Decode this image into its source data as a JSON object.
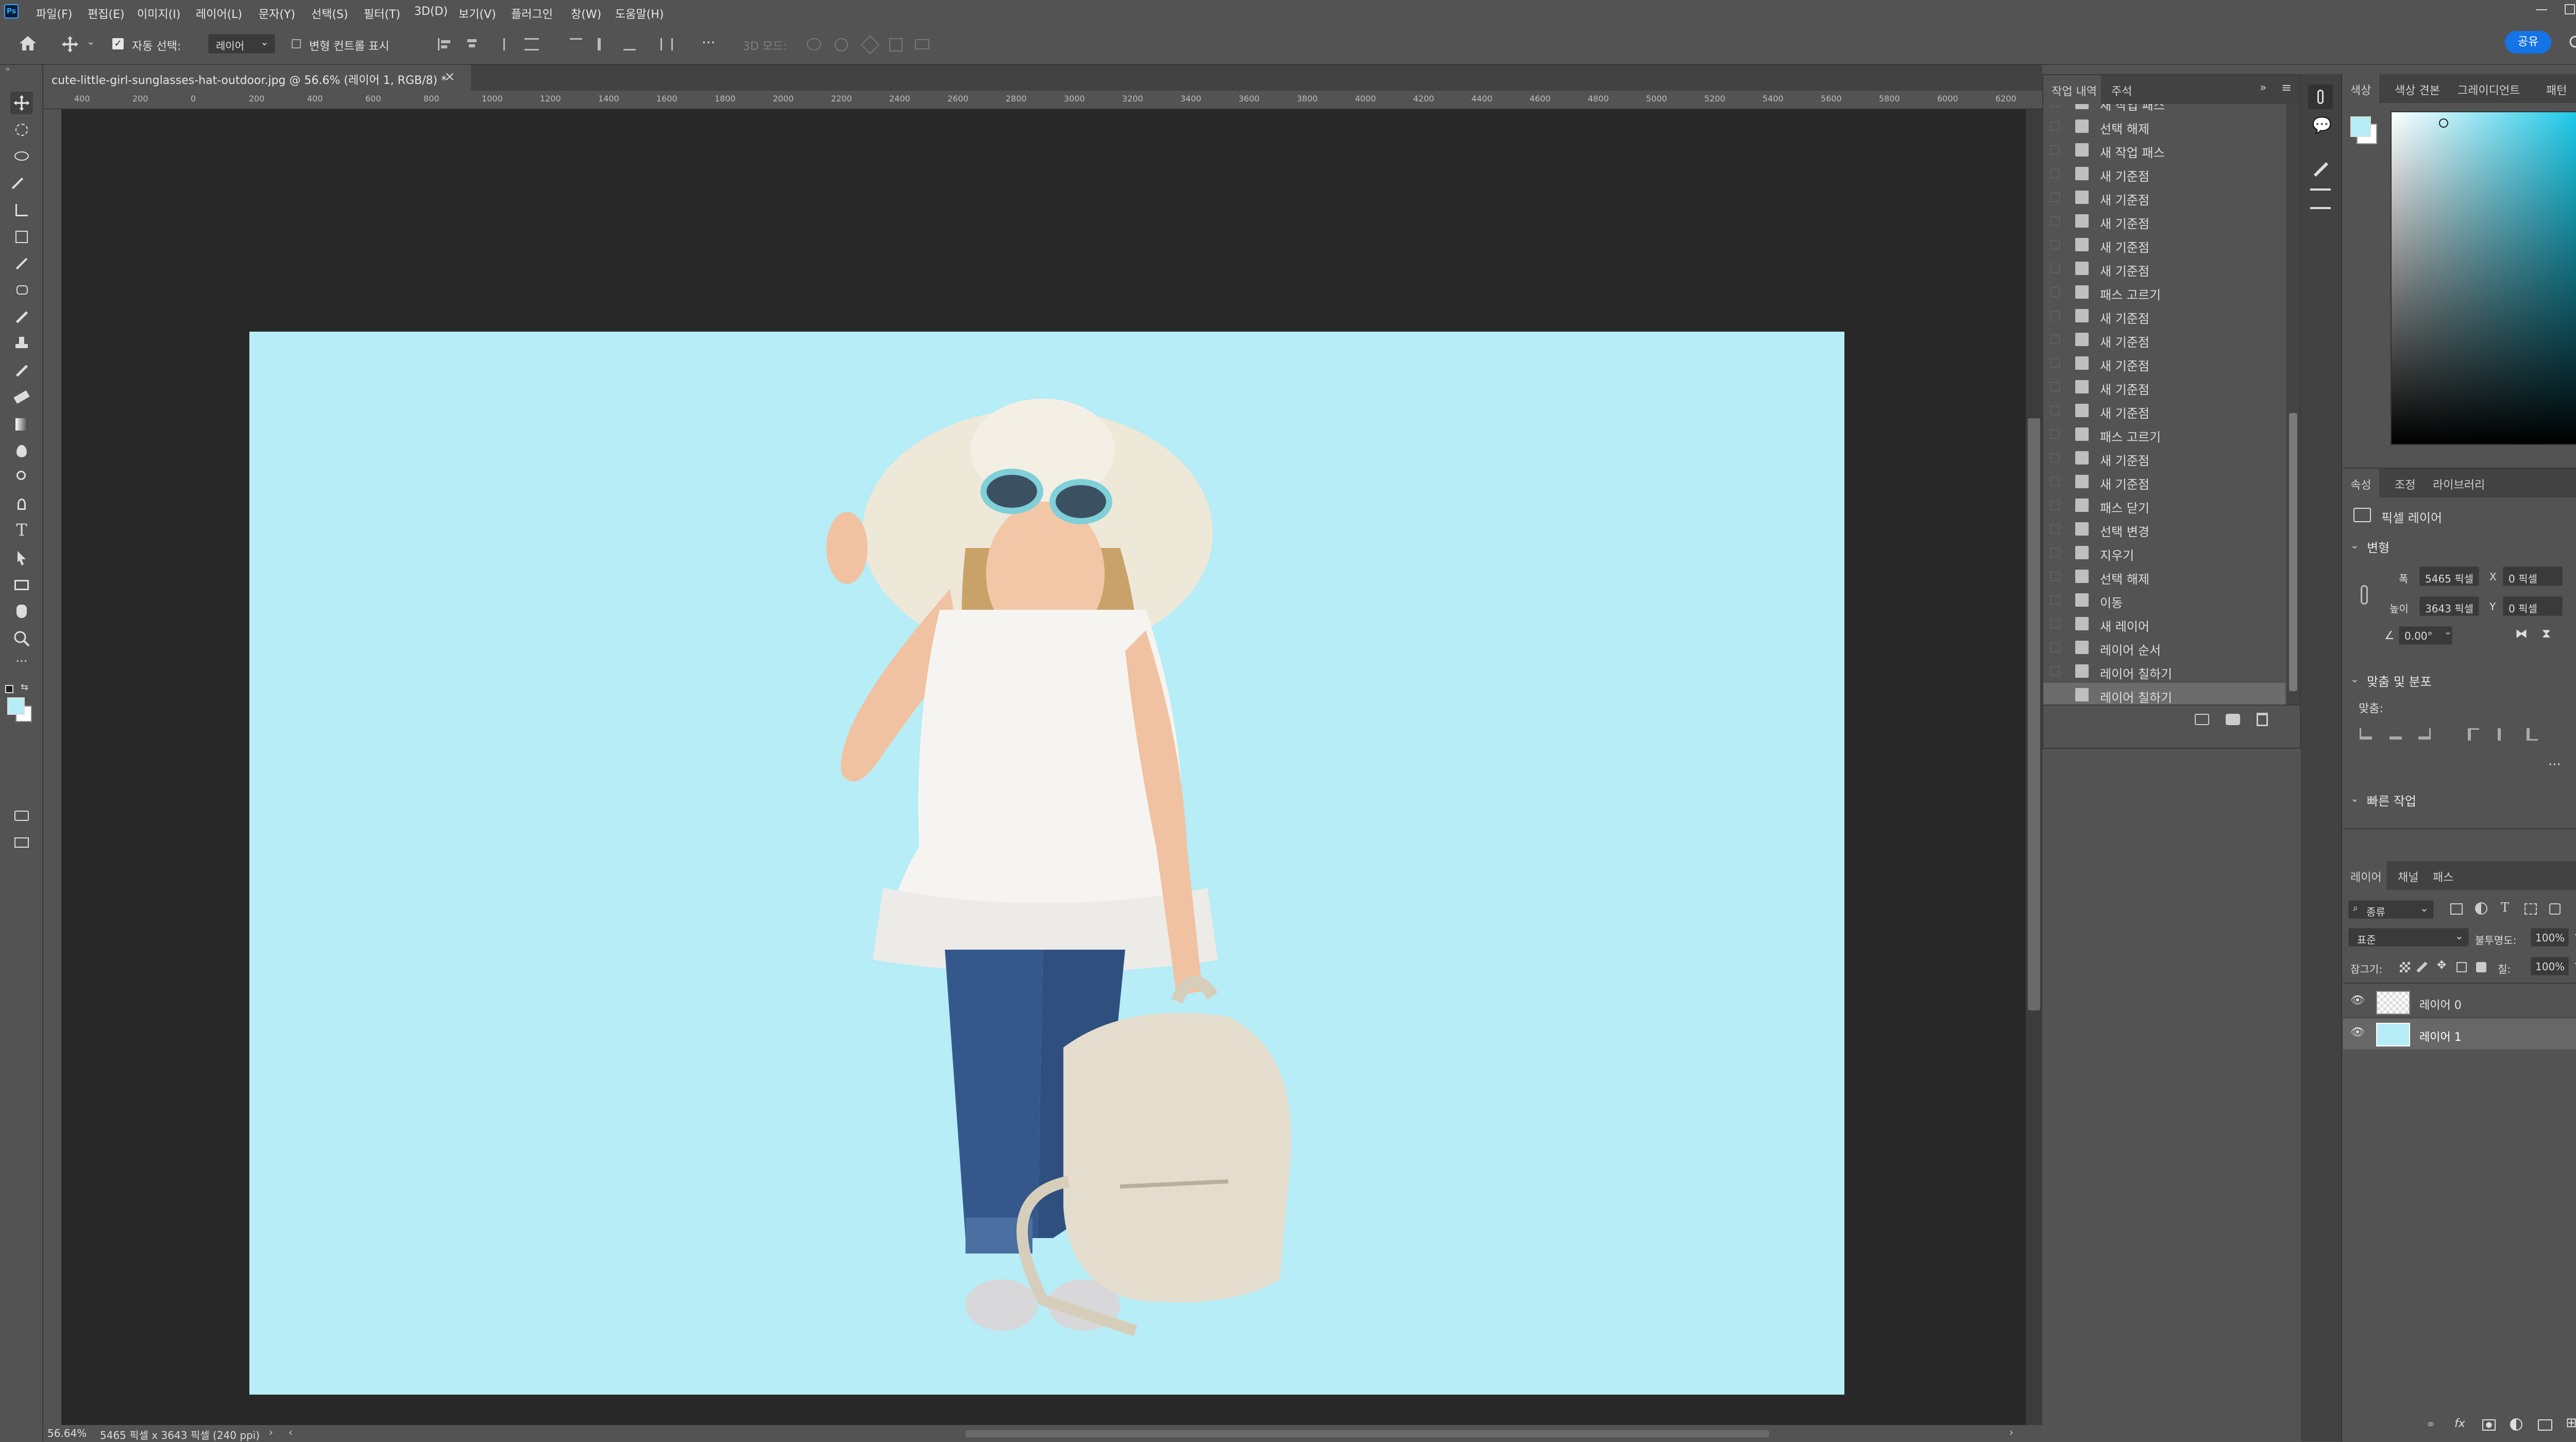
{
  "menu": {
    "logo": "Ps",
    "items": [
      "파일(F)",
      "편집(E)",
      "이미지(I)",
      "레이어(L)",
      "문자(Y)",
      "선택(S)",
      "필터(T)",
      "3D(D)",
      "보기(V)",
      "플러그인",
      "창(W)",
      "도움말(H)"
    ]
  },
  "options": {
    "auto_select_label": "자동 선택:",
    "auto_select_value": "레이어",
    "transform_controls_label": "변형 컨트롤 표시",
    "mode_3d_label": "3D 모드:",
    "share_label": "공유"
  },
  "document": {
    "tab_title": "cute-little-girl-sunglasses-hat-outdoor.jpg @ 56.6% (레이어 1, RGB/8) *",
    "status_zoom": "56.64%",
    "status_info": "5465 픽셀 x 3643 픽셀 (240 ppi)"
  },
  "ruler": {
    "top_ticks": [
      "400",
      "200",
      "0",
      "200",
      "400",
      "600",
      "800",
      "1000",
      "1200",
      "1400",
      "1600",
      "1800",
      "2000",
      "2200",
      "2400",
      "2600",
      "2800",
      "3000",
      "3200",
      "3400",
      "3600",
      "3800",
      "4000",
      "4200",
      "4400",
      "4600",
      "4800",
      "5000",
      "5200",
      "5400",
      "5600",
      "5800",
      "6000",
      "6200"
    ]
  },
  "history": {
    "tabs": [
      "작업 내역",
      "주석"
    ],
    "items": [
      "새 작업 패스",
      "선택 해제",
      "새 작업 패스",
      "새 기준점",
      "새 기준점",
      "새 기준점",
      "새 기준점",
      "새 기준점",
      "패스 고르기",
      "새 기준점",
      "새 기준점",
      "새 기준점",
      "새 기준점",
      "새 기준점",
      "패스 고르기",
      "새 기준점",
      "새 기준점",
      "패스 닫기",
      "선택 변경",
      "지우기",
      "선택 해제",
      "이동",
      "새 레이어",
      "레이어 순서",
      "레이어 칠하기",
      "레이어 칠하기"
    ],
    "selected_index": 25
  },
  "color_panel": {
    "tabs": [
      "색상",
      "색상 견본",
      "그레이디언트",
      "패턴"
    ],
    "foreground": "#b6edf6",
    "background": "#ffffff",
    "hue_color": "#16c8e8"
  },
  "properties": {
    "tabs": [
      "속성",
      "조정",
      "라이브러리"
    ],
    "layer_type": "픽셀 레이어",
    "transform_section": "변형",
    "width_label": "폭",
    "width_value": "5465 픽셀",
    "height_label": "높이",
    "height_value": "3643 픽셀",
    "x_label": "X",
    "x_value": "0 픽셀",
    "y_label": "Y",
    "y_value": "0 픽셀",
    "angle_value": "0.00°",
    "align_section": "맞춤 및 분포",
    "align_label": "맞춤:",
    "quick_actions": "빠른 작업"
  },
  "layers": {
    "tabs": [
      "레이어",
      "채널",
      "패스"
    ],
    "filter_kind": "종류",
    "blend_mode": "표준",
    "opacity_label": "불투명도:",
    "opacity_value": "100%",
    "lock_label": "잠그기:",
    "fill_label": "칠:",
    "fill_value": "100%",
    "items": [
      {
        "name": "레이어 0",
        "selected": false
      },
      {
        "name": "레이어 1",
        "selected": true
      }
    ]
  }
}
